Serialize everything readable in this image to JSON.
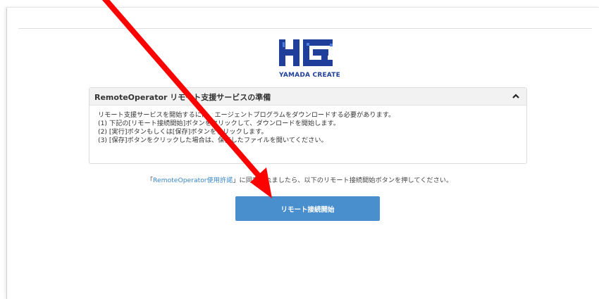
{
  "logo": {
    "text": "YAMADA CREATE",
    "colors": {
      "primary": "#1f3f9a",
      "accent": "#3b6fd6"
    }
  },
  "panel": {
    "title": "RemoteOperator リモート支援サービスの準備",
    "toggle_icon": "chevron-up-icon",
    "lines": [
      "リモート支援サービスを開始するには、エージェントプログラムをダウンロードする必要があります。",
      "(1) 下記の[リモート接続開始]ボタンをクリックして、ダウンロードを開始します。",
      "(2) [実行]ボタンもしくは[保存]ボタンをクリックします。",
      "(3) [保存]ボタンをクリックした場合は、保存したファイルを開いてください。"
    ]
  },
  "license": {
    "prefix": "「",
    "link": "RemoteOperator使用許諾",
    "suffix": "」に同意されましたら、以下のリモート接続開始ボタンを押してください。"
  },
  "start_button": {
    "label": "リモート接続開始",
    "color": "#4a8fcd"
  },
  "annotation": {
    "color": "#ff0000"
  }
}
